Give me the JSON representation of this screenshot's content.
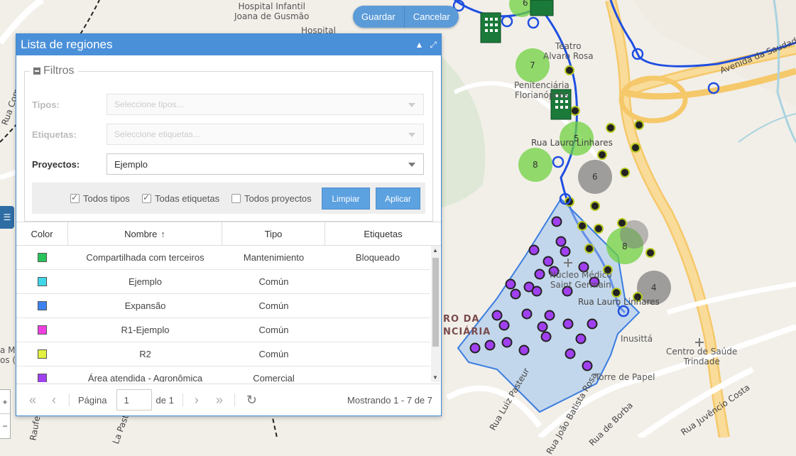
{
  "map_actions": {
    "save": "Guardar",
    "cancel": "Cancelar"
  },
  "map_labels": {
    "hospital_infantil": "Hospital Infantil\nJoana de Gusmão",
    "hospital": "Hospital",
    "teatro": "Teatro\nAlvaro Rosa",
    "penitenciaria": "Penitenciária\nFlorianópolis",
    "rua_lauro_linhares": "Rua Lauro Linhares",
    "nucleo": "Núcleo Médico\nSaint Germain",
    "rua_lauro_2": "Rua Lauro Linhares",
    "inusitta": "Inusittá",
    "torre": "Torre de Papel",
    "centro_saude": "Centro de Saúde\nTrindade",
    "avenida_saudade": "Avenida da Saudade",
    "rua_comandante": "Rua Comandante",
    "rua_luiz_pasteur": "Rua Luiz Pasteur",
    "rua_joao_batista": "Rua João Batista Rosa",
    "rua_borba": "Rua de Borba",
    "rua_juvencio": "Rua Juvêncio Costa",
    "centro_da": "RO DA",
    "penciaria": "NCIÁRIA",
    "rua_ma": "a M",
    "os": "os (0",
    "rua_la_pasta": "La Pasta",
    "rua_raufe": "Raufe"
  },
  "cluster_counts": [
    "6",
    "7",
    "5",
    "8",
    "6",
    "8",
    "4"
  ],
  "panel": {
    "title": "Lista de regiones",
    "filters": {
      "legend": "Filtros",
      "tipos_label": "Tipos:",
      "tipos_placeholder": "Seleccione tipos...",
      "etiquetas_label": "Etiquetas:",
      "etiquetas_placeholder": "Seleccione etiquetas...",
      "proyectos_label": "Proyectos:",
      "proyectos_value": "Ejemplo",
      "todos_tipos": "Todos tipos",
      "todas_etiquetas": "Todas etiquetas",
      "todos_proyectos": "Todos proyectos",
      "clear_button": "Limpiar",
      "apply_button": "Aplicar"
    },
    "table": {
      "headers": {
        "color": "Color",
        "nombre": "Nombre",
        "tipo": "Tipo",
        "etiquetas": "Etiquetas"
      },
      "rows": [
        {
          "color": "#27c45a",
          "nombre": "Compartilhada com terceiros",
          "tipo": "Mantenimiento",
          "etiquetas": "Bloqueado"
        },
        {
          "color": "#3fd6e8",
          "nombre": "Ejemplo",
          "tipo": "Común",
          "etiquetas": ""
        },
        {
          "color": "#3b82f0",
          "nombre": "Expansão",
          "tipo": "Común",
          "etiquetas": ""
        },
        {
          "color": "#f03fe0",
          "nombre": "R1-Ejemplo",
          "tipo": "Común",
          "etiquetas": ""
        },
        {
          "color": "#e2f03f",
          "nombre": "R2",
          "tipo": "Común",
          "etiquetas": ""
        },
        {
          "color": "#a040f0",
          "nombre": "Área atendida - Agronômica",
          "tipo": "Comercial",
          "etiquetas": ""
        }
      ]
    },
    "pager": {
      "page_label": "Página",
      "page_value": "1",
      "of_label": "de 1",
      "showing": "Mostrando 1 - 7 de 7"
    }
  },
  "colors": {
    "accent": "#4a90d9",
    "button": "#5ca1e0",
    "region_fill": "#9cc3ef",
    "line_blue": "#1f4fe0",
    "cluster_green": "#6fd13f",
    "cluster_gray": "#8a8a8a"
  }
}
